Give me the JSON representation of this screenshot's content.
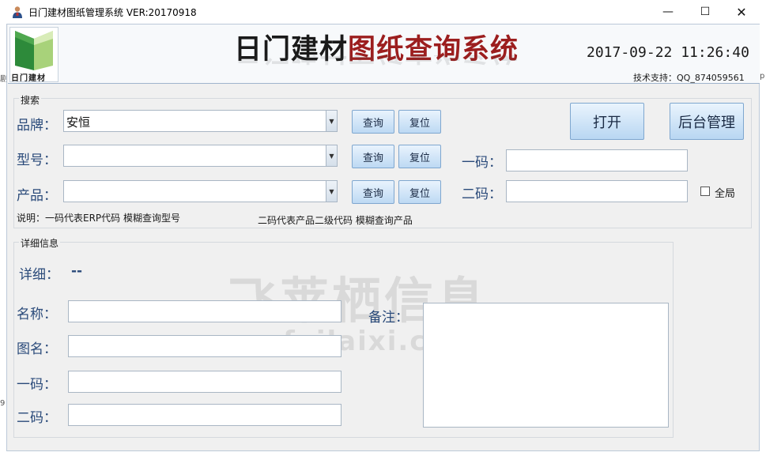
{
  "window": {
    "title": "日门建材图纸管理系统   VER:20170918",
    "minimize_glyph": "—",
    "maximize_glyph": "☐",
    "close_glyph": "✕"
  },
  "header": {
    "logo_text": "日门建材",
    "title_black": "日门建材",
    "title_red": "图纸查询系统",
    "datetime": "2017-09-22  11:26:40",
    "support": "技术支持：QQ_874059561"
  },
  "search": {
    "legend": "搜索",
    "brand_label": "品牌：",
    "brand_value": "安恒",
    "model_label": "型号：",
    "model_value": "",
    "product_label": "产品：",
    "product_value": "",
    "query_label": "查询",
    "reset_label": "复位",
    "code1_label": "一码：",
    "code2_label": "二码：",
    "global_label": "全局",
    "note1": "说明：一码代表ERP代码 模糊查询型号",
    "note2": "二码代表产品二级代码 模糊查询产品",
    "open_label": "打开",
    "admin_label": "后台管理"
  },
  "detail": {
    "legend": "详细信息",
    "detail_label": "详细：",
    "detail_value": "--",
    "name_label": "名称：",
    "drawing_label": "图名：",
    "code1_label": "一码：",
    "code2_label": "二码：",
    "remark_label": "备注："
  },
  "watermark": {
    "main": "飞莱栖信息",
    "sub": "feilaixi.com"
  },
  "edges": {
    "left_top": "剧",
    "left_bottom": "9",
    "right_top": "p"
  },
  "colors": {
    "title_red": "#9c1e1e",
    "label_blue": "#2a4a7a",
    "button_border": "#7fa7cf"
  }
}
